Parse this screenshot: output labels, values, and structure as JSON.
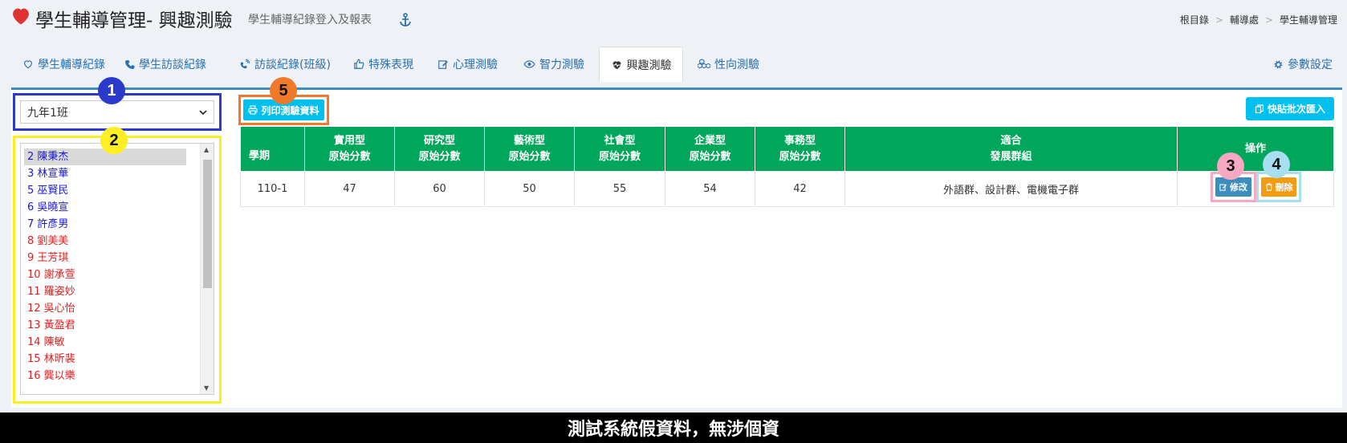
{
  "header": {
    "title": "學生輔導管理- 興趣測驗",
    "subtitle": "學生輔導紀錄登入及報表",
    "breadcrumb": [
      "根目錄",
      "輔導處",
      "學生輔導管理"
    ]
  },
  "tabs": [
    {
      "label": "學生輔導紀錄",
      "icon": "heart-outline-icon"
    },
    {
      "label": "學生訪談紀錄",
      "icon": "phone-icon"
    },
    {
      "label": "訪談紀錄(班級)",
      "icon": "volume-control-phone-icon"
    },
    {
      "label": "特殊表現",
      "icon": "thumbs-up-icon"
    },
    {
      "label": "心理測驗",
      "icon": "edit-icon"
    },
    {
      "label": "智力測驗",
      "icon": "eye-icon"
    },
    {
      "label": "興趣測驗",
      "icon": "heartbeat-icon",
      "active": true
    },
    {
      "label": "性向測驗",
      "icon": "cubes-icon"
    }
  ],
  "settings_tab": {
    "label": "參數設定",
    "icon": "gear-icon"
  },
  "class_select": {
    "value": "九年1班"
  },
  "students": [
    {
      "label": "2 陳秉杰",
      "color": "#1a1ad6",
      "selected": true
    },
    {
      "label": "3 林宣華",
      "color": "#1a1ad6"
    },
    {
      "label": "5 巫賢民",
      "color": "#1a1ad6"
    },
    {
      "label": "6 吳曉宣",
      "color": "#1a1ad6"
    },
    {
      "label": "7 許彥男",
      "color": "#1a1ad6"
    },
    {
      "label": "8 劉美美",
      "color": "#e02020"
    },
    {
      "label": "9 王芳琪",
      "color": "#e02020"
    },
    {
      "label": "10 謝承萱",
      "color": "#e02020"
    },
    {
      "label": "11 羅姿妙",
      "color": "#e02020"
    },
    {
      "label": "12 吳心怡",
      "color": "#e02020"
    },
    {
      "label": "13 黃盈君",
      "color": "#e02020"
    },
    {
      "label": "14 陳敏",
      "color": "#e02020"
    },
    {
      "label": "15 林昕裴",
      "color": "#e02020"
    },
    {
      "label": "16 龔以樂",
      "color": "#e02020"
    }
  ],
  "buttons": {
    "print": "列印測驗資料",
    "paste_import": "快貼批次匯入",
    "edit": "修改",
    "delete": "刪除"
  },
  "table": {
    "headers": [
      {
        "line1": "",
        "line2": "學期"
      },
      {
        "line1": "實用型",
        "line2": "原始分數"
      },
      {
        "line1": "研究型",
        "line2": "原始分數"
      },
      {
        "line1": "藝術型",
        "line2": "原始分數"
      },
      {
        "line1": "社會型",
        "line2": "原始分數"
      },
      {
        "line1": "企業型",
        "line2": "原始分數"
      },
      {
        "line1": "事務型",
        "line2": "原始分數"
      },
      {
        "line1": "適合",
        "line2": "發展群組"
      },
      {
        "line1": "操作",
        "line2": ""
      }
    ],
    "rows": [
      {
        "cells": [
          "110-1",
          "47",
          "60",
          "50",
          "55",
          "54",
          "42",
          "外語群、設計群、電機電子群"
        ]
      }
    ]
  },
  "markers": [
    {
      "num": "1",
      "color": "#2a3bcc",
      "text_color": "#ffffff"
    },
    {
      "num": "2",
      "color": "#ffee22",
      "text_color": "#111111"
    },
    {
      "num": "3",
      "color": "#f7a9c4",
      "text_color": "#111111"
    },
    {
      "num": "4",
      "color": "#a8dff0",
      "text_color": "#111111"
    },
    {
      "num": "5",
      "color": "#f07a2a",
      "text_color": "#111111"
    }
  ],
  "footer": {
    "text": "測試系統假資料，無涉個資"
  },
  "colors": {
    "accent_blue": "#3c8dbc",
    "header_green": "#00a65a",
    "info_button": "#00c0ef",
    "warning_button": "#f39c12",
    "heart_red": "#dd3333"
  }
}
